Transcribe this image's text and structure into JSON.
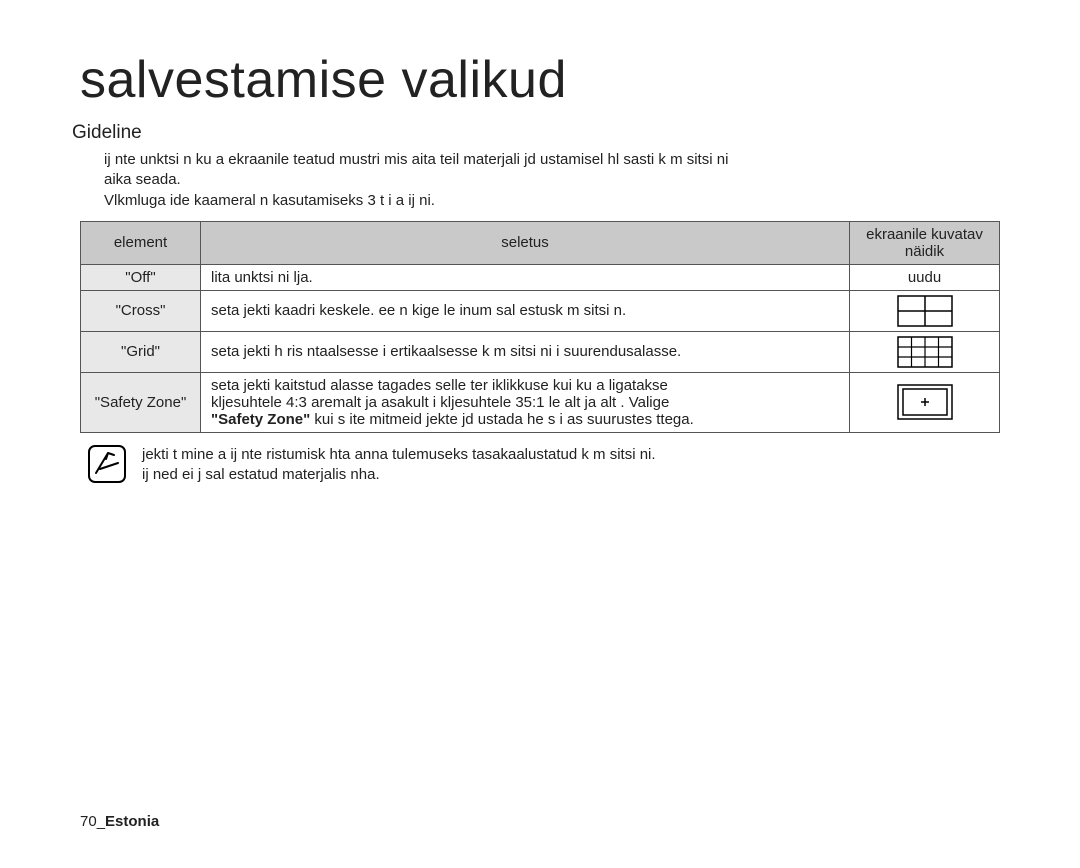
{
  "title": "salvestamise valikud",
  "section": "Gideline",
  "intro_lines": [
    "ij  nte  unktsi  n ku a     ekraanile teatud mustri  mis aita  teil materjali jd ustamisel hl sasti k m  sitsi  ni",
    "aika seada.",
    "Vlkmluga  ide kaameral  n kasutamiseks 3 t i a ij  ni."
  ],
  "table": {
    "headers": {
      "element": "element",
      "desc": "seletus",
      "display": "ekraanile kuvatav näidik"
    },
    "rows": [
      {
        "element": "\"Off\"",
        "desc": "lita    unktsi  ni  lja.",
        "display_text": "uudu",
        "icon": "none"
      },
      {
        "element": "\"Cross\"",
        "desc": "seta    jekti kaadri keskele.  ee  n kige le inum sal estusk m  sitsi  n.",
        "icon": "cross"
      },
      {
        "element": "\"Grid\"",
        "desc": "seta    jekti h ris ntaalsesse  i  ertikaalsesse k m  sitsi  ni  i suurendusalasse.",
        "icon": "grid"
      },
      {
        "element": "\"Safety Zone\"",
        "desc_line1": "seta    jekti kaitstud alasse  tagades selle ter iklikkuse  kui ku a ligatakse",
        "desc_line2": "kljesuhtele 4:3   aremalt ja  asakult   i kljesuhtele   35:1   le alt ja alt . Valige",
        "desc_bold": "\"Safety Zone\"",
        "desc_line3": "    kui s  ite mitmeid  jekte jd ustada  he  s  i as suurustes  ttega.",
        "icon": "safety"
      }
    ]
  },
  "note": {
    "line1": "jekti t  mine a ij  nte ristumisk hta anna  tulemuseks tasakaalustatud k m  sitsi  ni.",
    "line2": "ij  ned ei j  sal estatud materjalis nha."
  },
  "footer": {
    "page": "70",
    "sep": "_",
    "locale": "Estonia"
  }
}
